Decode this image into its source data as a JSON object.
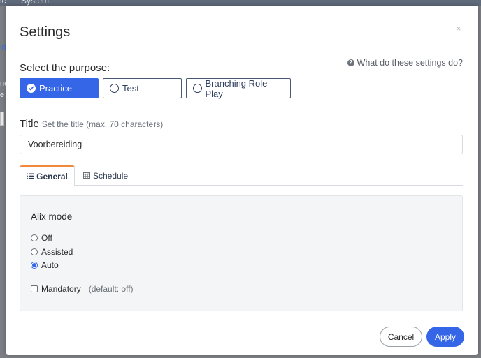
{
  "background": {
    "nav_items": [
      "ic",
      "System"
    ],
    "left_fragments": [
      "in",
      "ne",
      "e"
    ]
  },
  "modal": {
    "title": "Settings",
    "close_glyph": "×"
  },
  "help": {
    "icon": "question-circle-icon",
    "text": "What do these settings do?"
  },
  "purpose": {
    "label": "Select the purpose:",
    "options": [
      {
        "label": "Practice",
        "selected": true
      },
      {
        "label": "Test",
        "selected": false
      },
      {
        "label": "Branching Role Play",
        "selected": false
      }
    ]
  },
  "title_field": {
    "label": "Title",
    "hint": "Set the title (max. 70 characters)",
    "value": "Voorbereiding"
  },
  "tabs": [
    {
      "label": "General",
      "icon": "list-icon",
      "active": true
    },
    {
      "label": "Schedule",
      "icon": "calendar-icon",
      "active": false
    }
  ],
  "alix_mode": {
    "heading": "Alix mode",
    "options": [
      {
        "label": "Off",
        "selected": false
      },
      {
        "label": "Assisted",
        "selected": false
      },
      {
        "label": "Auto",
        "selected": true
      }
    ],
    "mandatory": {
      "label": "Mandatory",
      "note": "(default: off)",
      "checked": false
    }
  },
  "footer": {
    "cancel_label": "Cancel",
    "apply_label": "Apply"
  },
  "colors": {
    "accent": "#3566e8",
    "tab_active_top": "#f08a3c"
  }
}
